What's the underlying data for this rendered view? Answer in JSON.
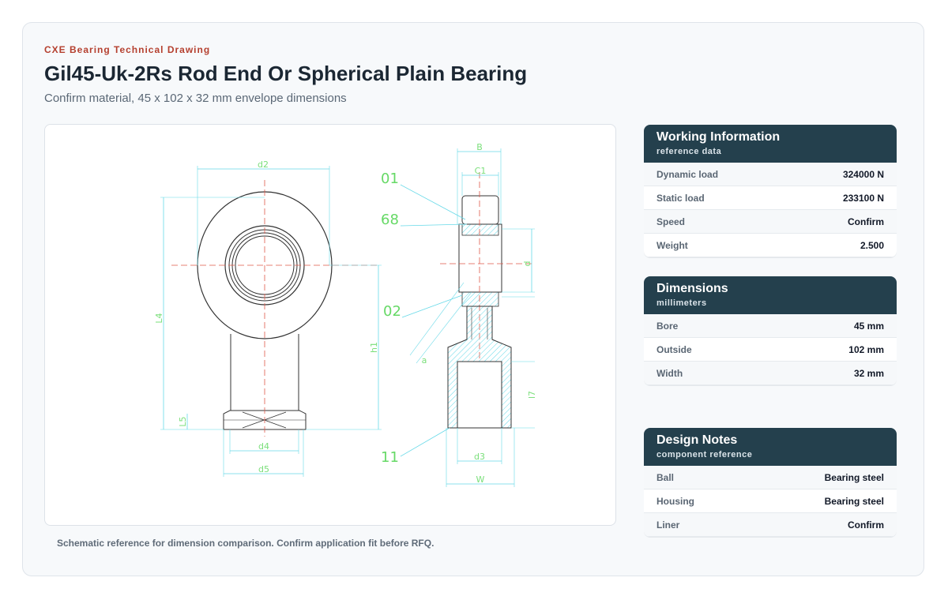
{
  "header": {
    "eyebrow": "CXE Bearing Technical Drawing",
    "title": "Gil45-Uk-2Rs Rod End Or Spherical Plain Bearing",
    "subtitle": "Confirm material, 45 x 102 x 32 mm envelope dimensions"
  },
  "drawing": {
    "labels": {
      "d2": "d2",
      "L4": "L4",
      "h1": "h1",
      "L5": "L5",
      "d4": "d4",
      "d5": "d5",
      "B": "B",
      "C1": "C1",
      "d": "d",
      "d3": "d3",
      "W": "W",
      "a": "a",
      "l7": "l7",
      "n01": "01",
      "n68": "68",
      "n02": "02",
      "n11": "11"
    },
    "caption": "Schematic reference for dimension comparison. Confirm application fit before RFQ."
  },
  "working": {
    "title": "Working Information",
    "subtitle": "reference data",
    "rows": [
      {
        "k": "Dynamic load",
        "v": "324000 N"
      },
      {
        "k": "Static load",
        "v": "233100 N"
      },
      {
        "k": "Speed",
        "v": "Confirm"
      },
      {
        "k": "Weight",
        "v": "2.500"
      }
    ]
  },
  "dimensions": {
    "title": "Dimensions",
    "subtitle": "millimeters",
    "rows": [
      {
        "k": "Bore",
        "v": "45 mm"
      },
      {
        "k": "Outside",
        "v": "102 mm"
      },
      {
        "k": "Width",
        "v": "32 mm"
      }
    ]
  },
  "notes": {
    "title": "Design Notes",
    "subtitle": "component reference",
    "rows": [
      {
        "k": "Ball",
        "v": "Bearing steel"
      },
      {
        "k": "Housing",
        "v": "Bearing steel"
      },
      {
        "k": "Liner",
        "v": "Confirm"
      }
    ]
  },
  "colors": {
    "accent": "#b5402f",
    "header_bg": "#24404d",
    "dimension_line": "#66d9e8",
    "dimension_text": "#7adf7a",
    "centerline": "#e0584a"
  }
}
